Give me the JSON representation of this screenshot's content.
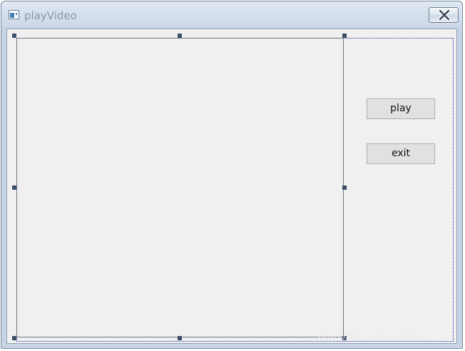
{
  "window": {
    "title": "playVideo",
    "icon": "app-window-icon",
    "close_icon": "close-x-icon"
  },
  "form": {
    "buttons": {
      "play_label": "play",
      "exit_label": "exit"
    }
  },
  "watermark": {
    "text": "https://blog.csdn.net/John_"
  },
  "colors": {
    "titlebar": "#cfdbea",
    "client_bg": "#f0f0f0",
    "selection_handle": "#3c4f66",
    "form_bounds_dotted": "#2a2aa8"
  }
}
